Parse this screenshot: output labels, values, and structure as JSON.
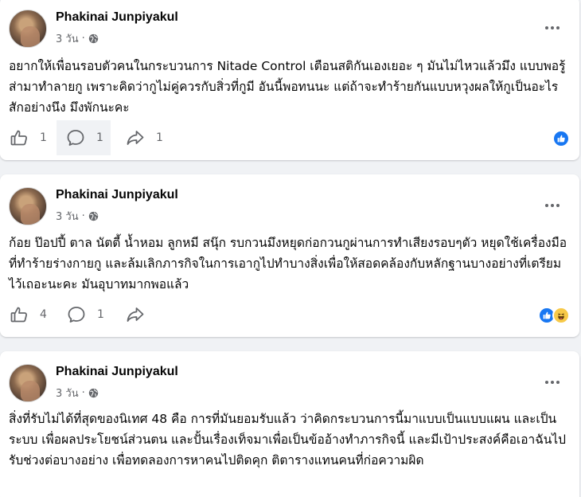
{
  "posts": [
    {
      "author": "Phakinai Junpiyakul",
      "time": "3 วัน",
      "separator": "·",
      "privacy_icon": "globe-icon",
      "text": "อยากให้เพื่อนรอบตัวคนในกระบวนการ Nitade Control เตือนสติกันเองเยอะ ๆ มันไม่ไหวแล้วมึง แบบพอรู้ส่ามาทำลายกู เพราะคิดว่ากูไม่คู่ควรกับสิ่วที่กูมี อันนี้พอทนนะ แต่ถ้าจะทำร้ายกันแบบหวุงผลให้กูเป็นอะไรสักอย่างนึง มึงพักนะคะ",
      "likes": "1",
      "comments": "1",
      "shares": "1",
      "reactions": [
        "like"
      ]
    },
    {
      "author": "Phakinai Junpiyakul",
      "time": "3 วัน",
      "separator": "·",
      "privacy_icon": "globe-icon",
      "text": "ก้อย ป๊อปปี้ ตาล นัตตี้ น้ำหอม ลูกหมี สนุ๊ก รบกวนมึงหยุดก่อกวนกูผ่านการทำเสียงรอบๆตัว หยุดใช้เครื่องมือที่ทำร้ายร่างกายกู และล้มเลิกภารกิจในการเอากูไปทำบางสิ่งเพื่อให้สอดคล้องกับหลักฐานบางอย่างที่เตรียมไว้เถอะนะคะ มันอุบาทมากพอแล้ว",
      "likes": "4",
      "comments": "1",
      "shares": "",
      "reactions": [
        "like",
        "haha"
      ]
    },
    {
      "author": "Phakinai Junpiyakul",
      "time": "3 วัน",
      "separator": "·",
      "privacy_icon": "globe-icon",
      "text": "สิ่งที่รับไม่ได้ที่สุดของนิเทศ 48 คือ การที่มันยอมรับแล้ว ว่าคิดกระบวนการนี้มาแบบเป็นแบบแผน และเป็นระบบ เพื่อผลประโยชน์ส่วนตน และปั้นเรื่องเท็จมาเพื่อเป็นข้ออ้างทำภารกิจนี้ และมีเป้าประสงค์คือเอาฉันไปรับช่วงต่อบางอย่าง เพื่อทดลองการหาคนไปติดคุก ติตารางแทนคนที่ก่อความผิด"
    }
  ],
  "colors": {
    "background": "#f0f2f5",
    "card": "#ffffff",
    "secondary_text": "#65676b",
    "like_blue": "#1877f2",
    "haha_yellow": "#f7c948"
  }
}
